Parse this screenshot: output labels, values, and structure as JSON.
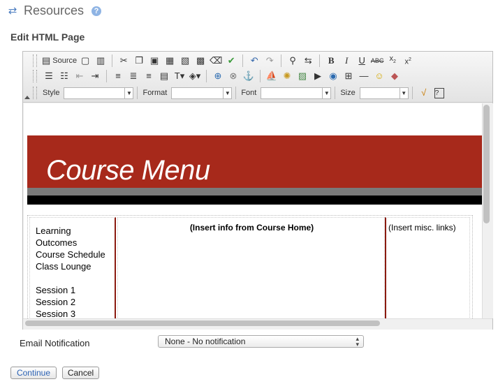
{
  "header": {
    "title": "Resources",
    "help_icon": "help-icon",
    "refresh_icon": "refresh-arrows-icon"
  },
  "subtitle": "Edit HTML Page",
  "toolbar": {
    "source_label": "Source",
    "style_label": "Style",
    "format_label": "Format",
    "font_label": "Font",
    "size_label": "Size",
    "row1_icons": [
      "source-icon",
      "new-page-icon",
      "templates-icon",
      "cut-icon",
      "copy-icon",
      "paste-icon",
      "paste-text-icon",
      "paste-word-icon",
      "select-all-icon",
      "remove-format-icon",
      "spellcheck-icon",
      "undo-icon",
      "redo-icon",
      "find-icon",
      "replace-icon",
      "bold-icon",
      "italic-icon",
      "underline-icon",
      "strike-icon",
      "subscript-icon",
      "superscript-icon"
    ],
    "row2_icons": [
      "numbered-list-icon",
      "bulleted-list-icon",
      "outdent-icon",
      "indent-icon",
      "align-left-icon",
      "align-center-icon",
      "align-right-icon",
      "justify-icon",
      "text-color-icon",
      "bg-color-icon",
      "link-icon",
      "unlink-icon",
      "anchor-icon",
      "equation-icon",
      "flash-icon",
      "image-icon",
      "media-icon",
      "browse-icon",
      "table-icon",
      "horizontal-rule-icon",
      "smiley-icon",
      "special-char-icon"
    ]
  },
  "content": {
    "banner_title": "Course Menu",
    "left_menu": [
      "Learning",
      "Outcomes",
      "Course Schedule",
      "Class Lounge"
    ],
    "sessions": [
      "Session 1",
      "Session 2",
      "Session 3"
    ],
    "mid_text": "(Insert info from Course Home)",
    "right_text": "(Insert misc. links)"
  },
  "notification": {
    "label": "Email Notification",
    "selected": "None - No notification"
  },
  "buttons": {
    "continue": "Continue",
    "cancel": "Cancel"
  },
  "colors": {
    "banner_red": "#a7291b",
    "divider_red": "#8b1a10",
    "link_blue": "#2b62b4"
  }
}
